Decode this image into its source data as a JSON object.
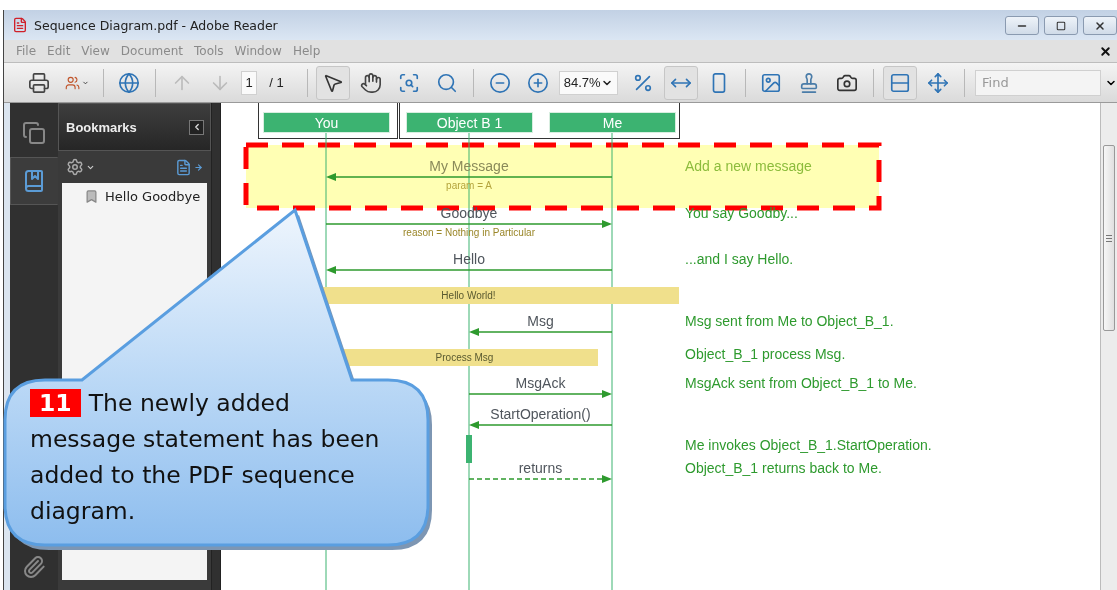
{
  "window": {
    "title": "Sequence Diagram.pdf - Adobe Reader"
  },
  "menu": [
    "File",
    "Edit",
    "View",
    "Document",
    "Tools",
    "Window",
    "Help"
  ],
  "toolbar": [
    {
      "kind": "print",
      "selected": false
    },
    {
      "kind": "share",
      "selected": false
    },
    {
      "kind": "separator"
    },
    {
      "kind": "web",
      "selected": false
    },
    {
      "kind": "separator"
    },
    {
      "kind": "prev",
      "selected": false,
      "disabled": true
    },
    {
      "kind": "next",
      "selected": false,
      "disabled": true
    },
    {
      "kind": "page-field",
      "value": "1"
    },
    {
      "kind": "page-total",
      "text": "/ 1"
    },
    {
      "kind": "separator"
    },
    {
      "kind": "select",
      "selected": true
    },
    {
      "kind": "hand",
      "selected": false
    },
    {
      "kind": "marquee",
      "selected": false
    },
    {
      "kind": "zoom",
      "selected": false
    },
    {
      "kind": "separator"
    },
    {
      "kind": "zoom-out",
      "selected": false
    },
    {
      "kind": "zoom-in",
      "selected": false
    },
    {
      "kind": "zoom-field",
      "value": "84.7%"
    },
    {
      "kind": "actual-size",
      "selected": false
    },
    {
      "kind": "fit-width",
      "selected": true
    },
    {
      "kind": "fit-page",
      "selected": false
    },
    {
      "kind": "separator"
    },
    {
      "kind": "image",
      "selected": false
    },
    {
      "kind": "stamp",
      "selected": false
    },
    {
      "kind": "snapshot",
      "selected": false
    },
    {
      "kind": "separator"
    },
    {
      "kind": "scroll-mode",
      "selected": true
    },
    {
      "kind": "full-screen",
      "selected": false
    },
    {
      "kind": "separator"
    },
    {
      "kind": "find-field",
      "placeholder": "Find"
    }
  ],
  "nav": [
    {
      "kind": "pages",
      "selected": false
    },
    {
      "kind": "bookmarks",
      "selected": true
    },
    {
      "kind": "attachments",
      "selected": false
    }
  ],
  "sidebar": {
    "title": "Bookmarks",
    "bookmarks": [
      {
        "label": "Hello Goodbye"
      }
    ]
  },
  "diagram": {
    "participants": [
      {
        "name": "You"
      },
      {
        "name": "Object B 1"
      },
      {
        "name": "Me"
      }
    ],
    "rows": [
      {
        "kind": "message",
        "label": "My Message",
        "detail": "param = A",
        "note": "Add a new message",
        "highlighted": true
      },
      {
        "kind": "message",
        "label": "Goodbye",
        "detail": "reason = Nothing in Particular",
        "note": "You say Goodby...",
        "highlighted": false
      },
      {
        "kind": "message",
        "label": "Hello",
        "note": "...and I say Hello.",
        "highlighted": false
      },
      {
        "kind": "note-bar",
        "label": "Hello World!",
        "highlighted": false
      },
      {
        "kind": "message",
        "label": "Msg",
        "note": "Msg sent from Me to Object_B_1.",
        "highlighted": false
      },
      {
        "kind": "note-bar",
        "label": "Process Msg",
        "note": "Object_B_1 process Msg.",
        "highlighted": false
      },
      {
        "kind": "message",
        "label": "MsgAck",
        "note": "MsgAck sent from Object_B_1 to Me.",
        "highlighted": false
      },
      {
        "kind": "message",
        "label": "StartOperation()",
        "highlighted": false
      },
      {
        "kind": "activation",
        "note": "Me invokes Object_B_1.StartOperation.",
        "highlighted": false
      },
      {
        "kind": "return",
        "label": "returns",
        "note": "Object_B_1 returns back to Me.",
        "highlighted": false
      }
    ]
  },
  "callout": {
    "number": "11",
    "text": "The newly added message statement has been added to the PDF sequence diagram."
  }
}
